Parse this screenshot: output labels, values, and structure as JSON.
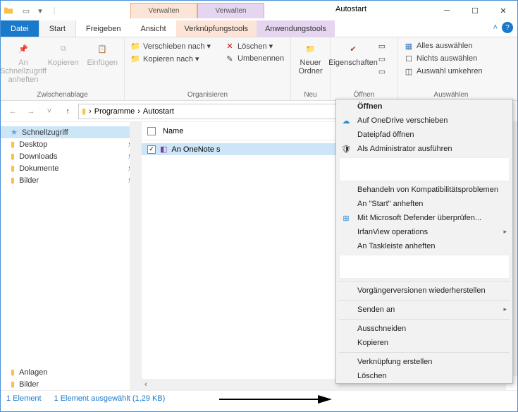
{
  "window": {
    "title": "Autostart"
  },
  "manage": {
    "tab1": "Verwalten",
    "tab2": "Verwalten"
  },
  "tabs": {
    "file": "Datei",
    "start": "Start",
    "share": "Freigeben",
    "view": "Ansicht",
    "tool1": "Verknüpfungstools",
    "tool2": "Anwendungstools"
  },
  "ribbon": {
    "clipboard": {
      "pin": "An Schnellzugriff anheften",
      "copy": "Kopieren",
      "paste": "Einfügen",
      "label": "Zwischenablage"
    },
    "organize": {
      "move": "Verschieben nach ▾",
      "copyto": "Kopieren nach ▾",
      "delete": "Löschen ▾",
      "rename": "Umbenennen",
      "label": "Organisieren"
    },
    "new": {
      "folder": "Neuer Ordner",
      "label": "Neu"
    },
    "open": {
      "props": "Eigenschaften",
      "label": "Öffnen"
    },
    "select": {
      "all": "Alles auswählen",
      "none": "Nichts auswählen",
      "invert": "Auswahl umkehren",
      "label": "Auswählen"
    }
  },
  "path": {
    "seg1": "Programme",
    "seg2": "Autostart",
    "sep": "›"
  },
  "sidebar": {
    "quick": "Schnellzugriff",
    "desktop": "Desktop",
    "downloads": "Downloads",
    "documents": "Dokumente",
    "pictures": "Bilder",
    "attachments": "Anlagen",
    "pictures2": "Bilder"
  },
  "columns": {
    "name": "Name"
  },
  "files": {
    "item1": "An OneNote s"
  },
  "status": {
    "count": "1 Element",
    "selected": "1 Element ausgewählt (1,29 KB)"
  },
  "ctx": {
    "open": "Öffnen",
    "onedrive": "Auf OneDrive verschieben",
    "openpath": "Dateipfad öffnen",
    "runadmin": "Als Administrator ausführen",
    "compat": "Behandeln von Kompatibilitätsproblemen",
    "pinstart": "An \"Start\" anheften",
    "defender": "Mit Microsoft Defender überprüfen...",
    "irfan": "IrfanView operations",
    "taskbar": "An Taskleiste anheften",
    "prev": "Vorgängerversionen wiederherstellen",
    "sendto": "Senden an",
    "cut": "Ausschneiden",
    "copy": "Kopieren",
    "shortcut": "Verknüpfung erstellen",
    "delete": "Löschen"
  }
}
